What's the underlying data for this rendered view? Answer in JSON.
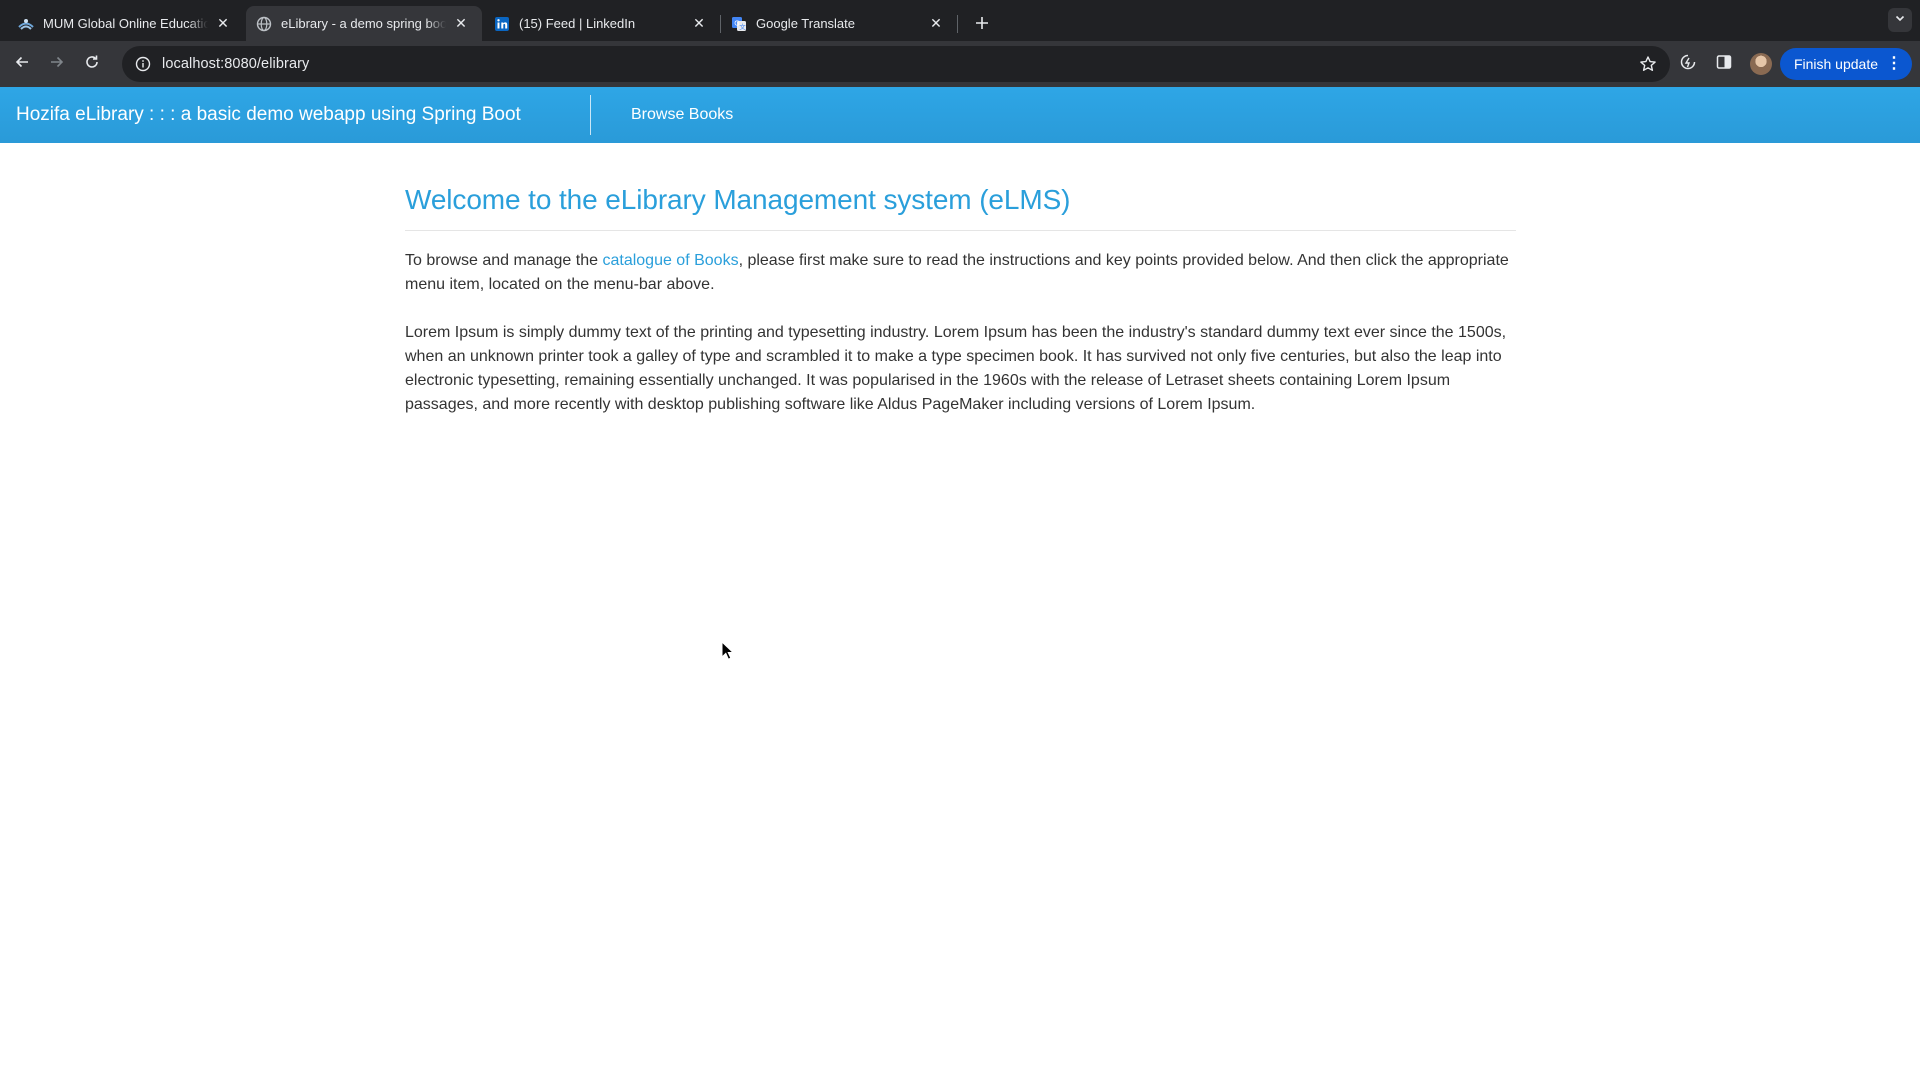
{
  "browser": {
    "tabs": [
      {
        "title": "MUM Global Online Education",
        "icon": "mum-logo-icon",
        "active": false
      },
      {
        "title": "eLibrary - a demo spring boot",
        "icon": "globe-icon",
        "active": true
      },
      {
        "title": "(15) Feed | LinkedIn",
        "icon": "linkedin-icon",
        "active": false
      },
      {
        "title": "Google Translate",
        "icon": "google-translate-icon",
        "active": false
      }
    ],
    "address": "localhost:8080/elibrary",
    "finish_update_label": "Finish update"
  },
  "app": {
    "brand": "Hozifa eLibrary : : : a basic demo webapp using Spring Boot",
    "nav_link": "Browse Books"
  },
  "main": {
    "title": "Welcome to the eLibrary Management system (eLMS)",
    "intro_before": "To browse and manage the ",
    "intro_link": "catalogue of Books",
    "intro_after": ", please first make sure to read the instructions and key points provided below. And then click the appropriate menu item, located on the menu-bar above.",
    "lorem": "Lorem Ipsum is simply dummy text of the printing and typesetting industry. Lorem Ipsum has been the industry's standard dummy text ever since the 1500s, when an unknown printer took a galley of type and scrambled it to make a type specimen book. It has survived not only five centuries, but also the leap into electronic typesetting, remaining essentially unchanged. It was popularised in the 1960s with the release of Letraset sheets containing Lorem Ipsum passages, and more recently with desktop publishing software like Aldus PageMaker including versions of Lorem Ipsum."
  },
  "colors": {
    "navbar": "#2ea6e6",
    "accent": "#2a9fdb",
    "chrome_dark": "#202124",
    "chrome_toolbar": "#35363a",
    "update_button": "#0b57d0"
  }
}
